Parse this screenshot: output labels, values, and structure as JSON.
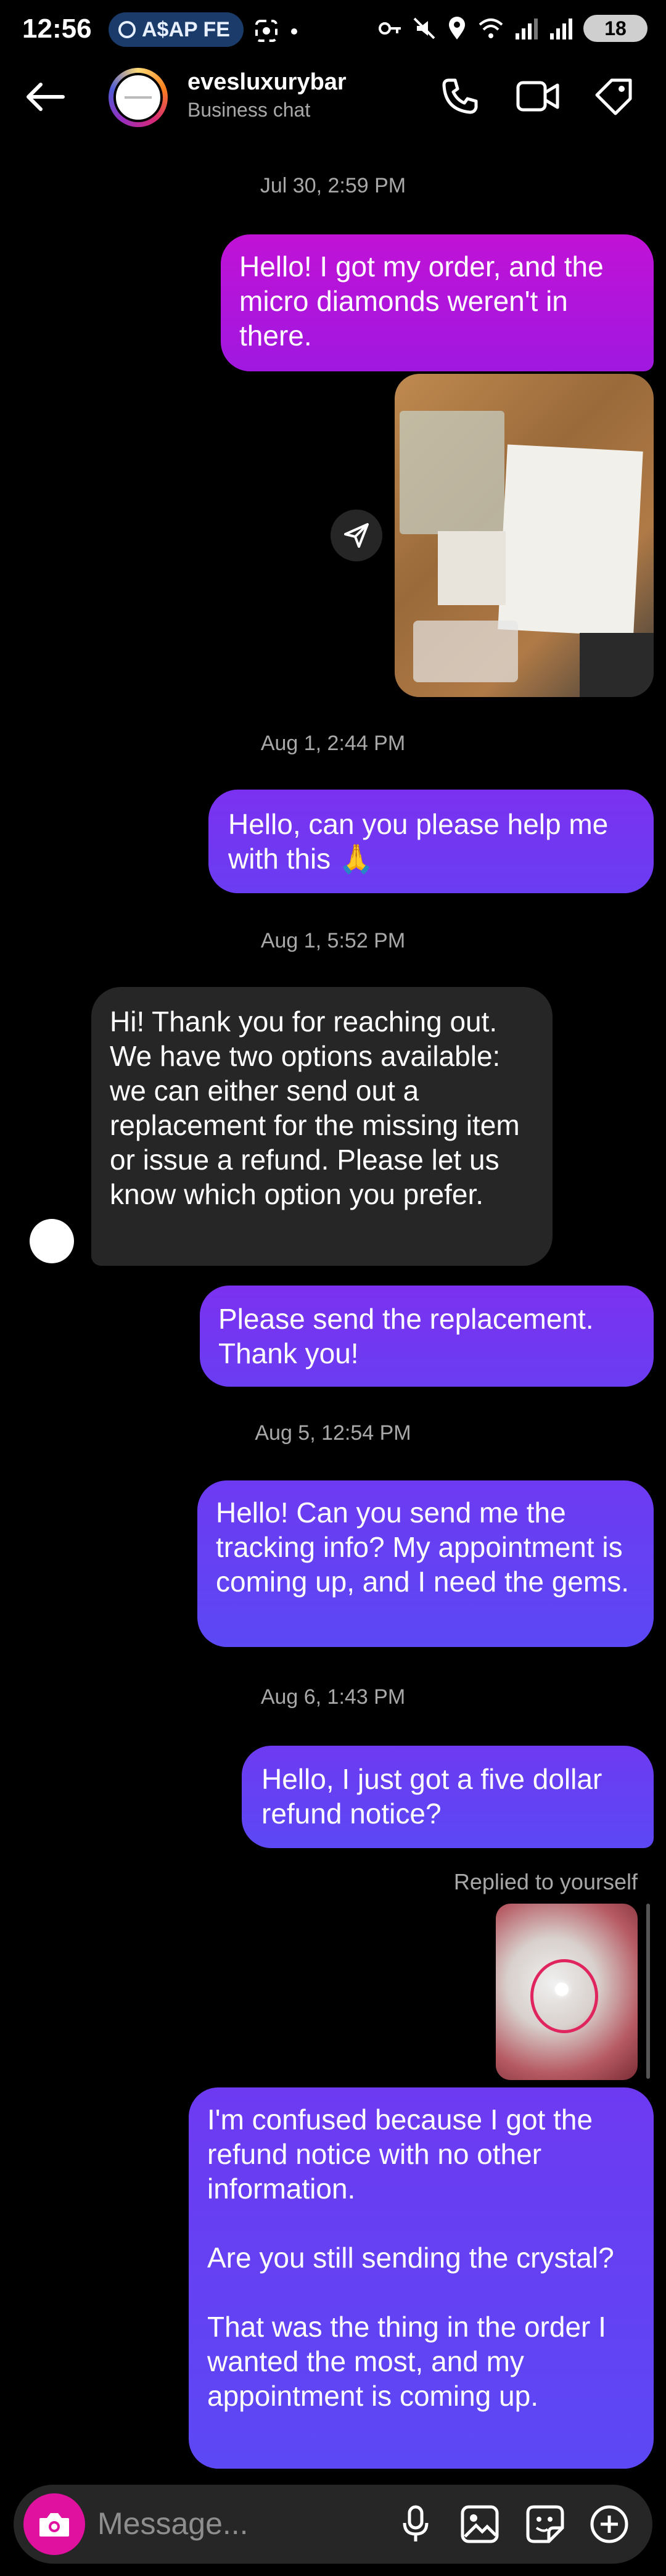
{
  "status_bar": {
    "time": "12:56",
    "notification": "A$AP FE",
    "battery": "18"
  },
  "header": {
    "name": "evesluxurybar",
    "subtitle": "Business chat",
    "icons": [
      "back-arrow-icon",
      "phone-icon",
      "video-icon",
      "tag-icon"
    ]
  },
  "conversation": {
    "ts1": "Jul 30, 2:59 PM",
    "msg1": "Hello! I got my order, and the micro diamonds weren't in there.",
    "ts2": "Aug 1, 2:44 PM",
    "msg2": "Hello, can you please help me with this 🙏",
    "ts3": "Aug 1, 5:52 PM",
    "msg3": "Hi! Thank you for reaching out. We have two options available: we can either send out a replacement for the missing item or issue a refund. Please let us know which option you prefer.",
    "msg4": "Please send the replacement. Thank you!",
    "ts4": "Aug 5, 12:54 PM",
    "msg5": "Hello! Can you send me the tracking info? My appointment is coming up, and I need the gems.",
    "ts5": "Aug 6, 1:43 PM",
    "msg6": "Hello, I just got a five dollar refund notice?",
    "reply_label": "Replied to yourself",
    "msg7": "I'm confused because I got the refund notice with no other information.\n\nAre you still sending the crystal?\n\nThat was the thing in the order I wanted the most, and my appointment is coming up."
  },
  "composer": {
    "placeholder": "Message..."
  },
  "colors": {
    "outgoing_magenta": "#b514da",
    "outgoing_purple": "#6f38f1",
    "incoming": "#262626",
    "camera": "#e0119e"
  }
}
